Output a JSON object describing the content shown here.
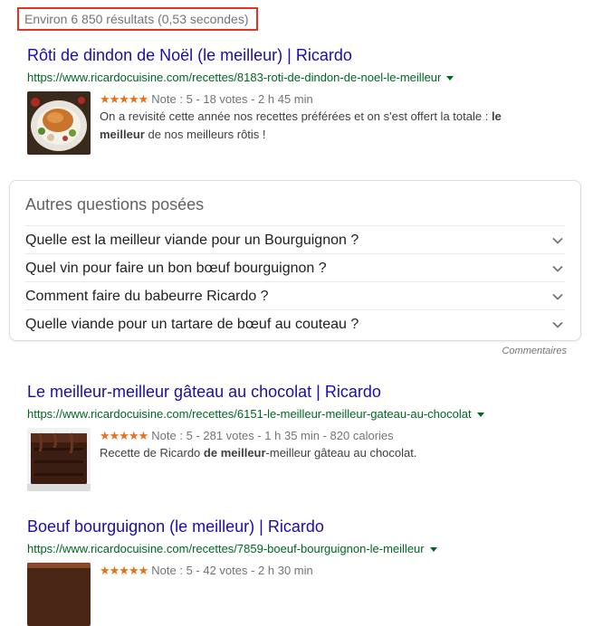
{
  "stats": "Environ 6 850 résultats (0,53 secondes)",
  "results": [
    {
      "title": "Rôti de dindon de Noël (le meilleur) | Ricardo",
      "url": "https://www.ricardocuisine.com/recettes/8183-roti-de-dindon-de-noel-le-meilleur",
      "stars": "★★★★★",
      "meta": "Note : 5 - 18 votes - 2 h 45 min",
      "snippet": {
        "line1_pre": "On a revisité cette année nos recettes préférées et on s'est offert la totale : ",
        "line1_bold": "le",
        "line2_bold": "meilleur",
        "line2_post": " de nos meilleurs rôtis !"
      }
    },
    {
      "title": "Le meilleur-meilleur gâteau au chocolat | Ricardo",
      "url": "https://www.ricardocuisine.com/recettes/6151-le-meilleur-meilleur-gateau-au-chocolat",
      "stars": "★★★★★",
      "meta": "Note : 5 - 281 votes - 1 h 35 min - 820 calories",
      "snippet": {
        "pre": "Recette de Ricardo ",
        "bold": "de meilleur",
        "post": "-meilleur gâteau au chocolat."
      }
    },
    {
      "title": "Boeuf bourguignon (le meilleur) | Ricardo",
      "url": "https://www.ricardocuisine.com/recettes/7859-boeuf-bourguignon-le-meilleur",
      "stars": "★★★★★",
      "meta": "Note : 5 - 42 votes - 2 h 30 min"
    }
  ],
  "paa": {
    "title": "Autres questions posées",
    "questions": [
      "Quelle est la meilleur viande pour un Bourguignon ?",
      "Quel vin pour faire un bon bœuf bourguignon ?",
      "Comment faire du babeurre Ricardo ?",
      "Quelle viande pour un tartare de bœuf au couteau ?"
    ],
    "feedback": "Commentaires"
  },
  "colors": {
    "title_link": "#1a0dab",
    "url": "#006621",
    "stars": "#e7711b",
    "highlight_border": "#e53323"
  }
}
